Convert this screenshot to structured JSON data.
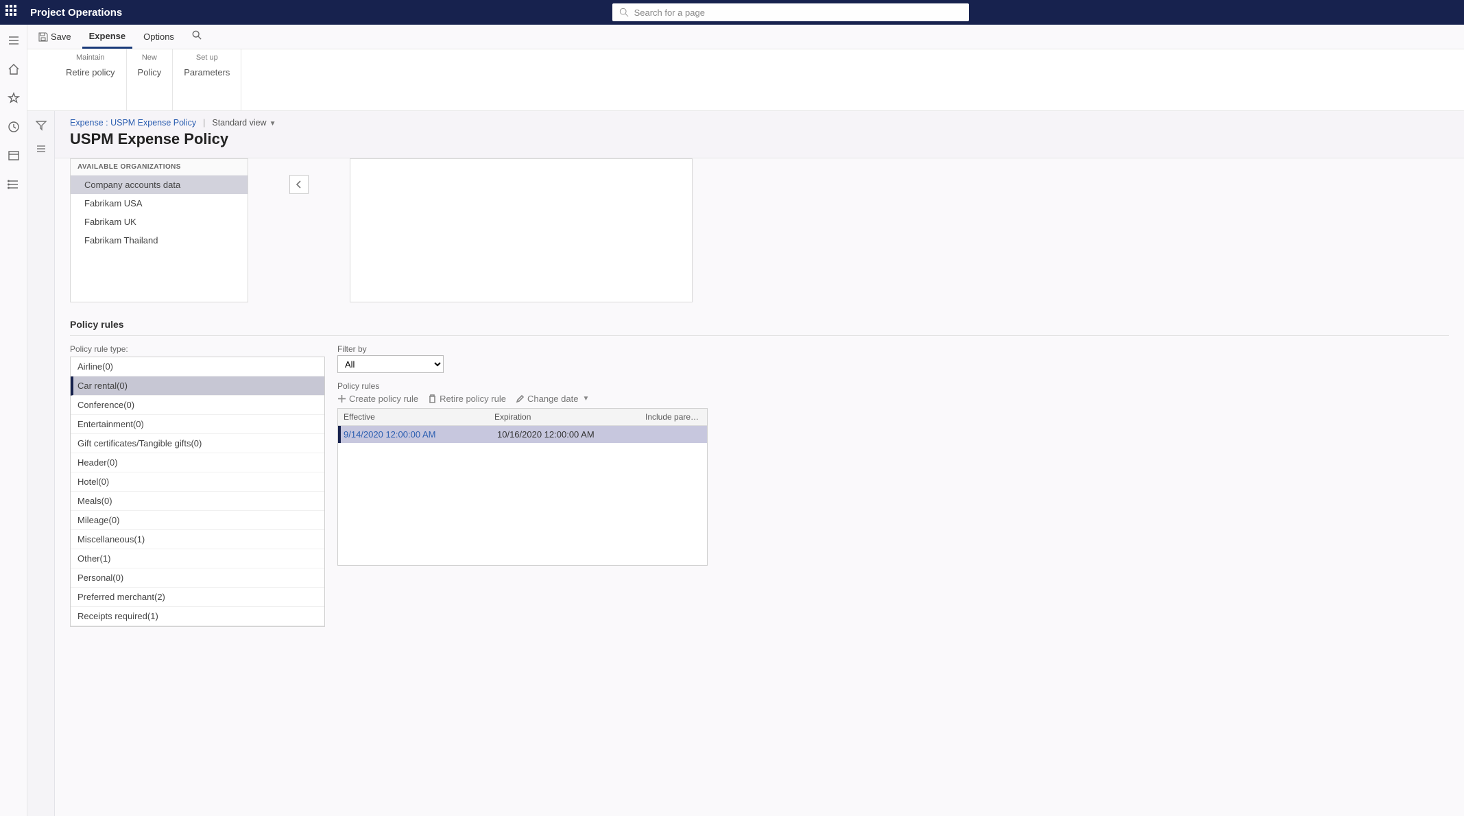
{
  "app": {
    "title": "Project Operations"
  },
  "search": {
    "placeholder": "Search for a page"
  },
  "cmdbar": {
    "save": "Save",
    "tab_expense": "Expense",
    "tab_options": "Options"
  },
  "ribbon": {
    "maintain": {
      "label": "Maintain",
      "items": [
        "Retire policy"
      ]
    },
    "new": {
      "label": "New",
      "items": [
        "Policy"
      ]
    },
    "setup": {
      "label": "Set up",
      "items": [
        "Parameters"
      ]
    }
  },
  "breadcrumb": {
    "path": "Expense : USPM Expense Policy",
    "view": "Standard view"
  },
  "page": {
    "title": "USPM Expense Policy"
  },
  "orgs": {
    "section_label": "AVAILABLE ORGANIZATIONS",
    "items": [
      {
        "label": "Company accounts data",
        "selected": true
      },
      {
        "label": "Fabrikam USA",
        "selected": false
      },
      {
        "label": "Fabrikam UK",
        "selected": false
      },
      {
        "label": "Fabrikam Thailand",
        "selected": false
      }
    ]
  },
  "section": {
    "policy_rules": "Policy rules"
  },
  "rule_types": {
    "label": "Policy rule type:",
    "items": [
      "Airline(0)",
      "Car rental(0)",
      "Conference(0)",
      "Entertainment(0)",
      "Gift certificates/Tangible gifts(0)",
      "Header(0)",
      "Hotel(0)",
      "Meals(0)",
      "Mileage(0)",
      "Miscellaneous(1)",
      "Other(1)",
      "Personal(0)",
      "Preferred merchant(2)",
      "Receipts required(1)"
    ],
    "selected_index": 1
  },
  "filter": {
    "label": "Filter by",
    "value": "All"
  },
  "policy_rules": {
    "label": "Policy rules",
    "create": "Create policy rule",
    "retire": "Retire policy rule",
    "change": "Change date",
    "columns": {
      "effective": "Effective",
      "expiration": "Expiration",
      "include": "Include paren..."
    },
    "rows": [
      {
        "effective": "9/14/2020 12:00:00 AM",
        "expiration": "10/16/2020 12:00:00 AM",
        "include": ""
      }
    ]
  }
}
